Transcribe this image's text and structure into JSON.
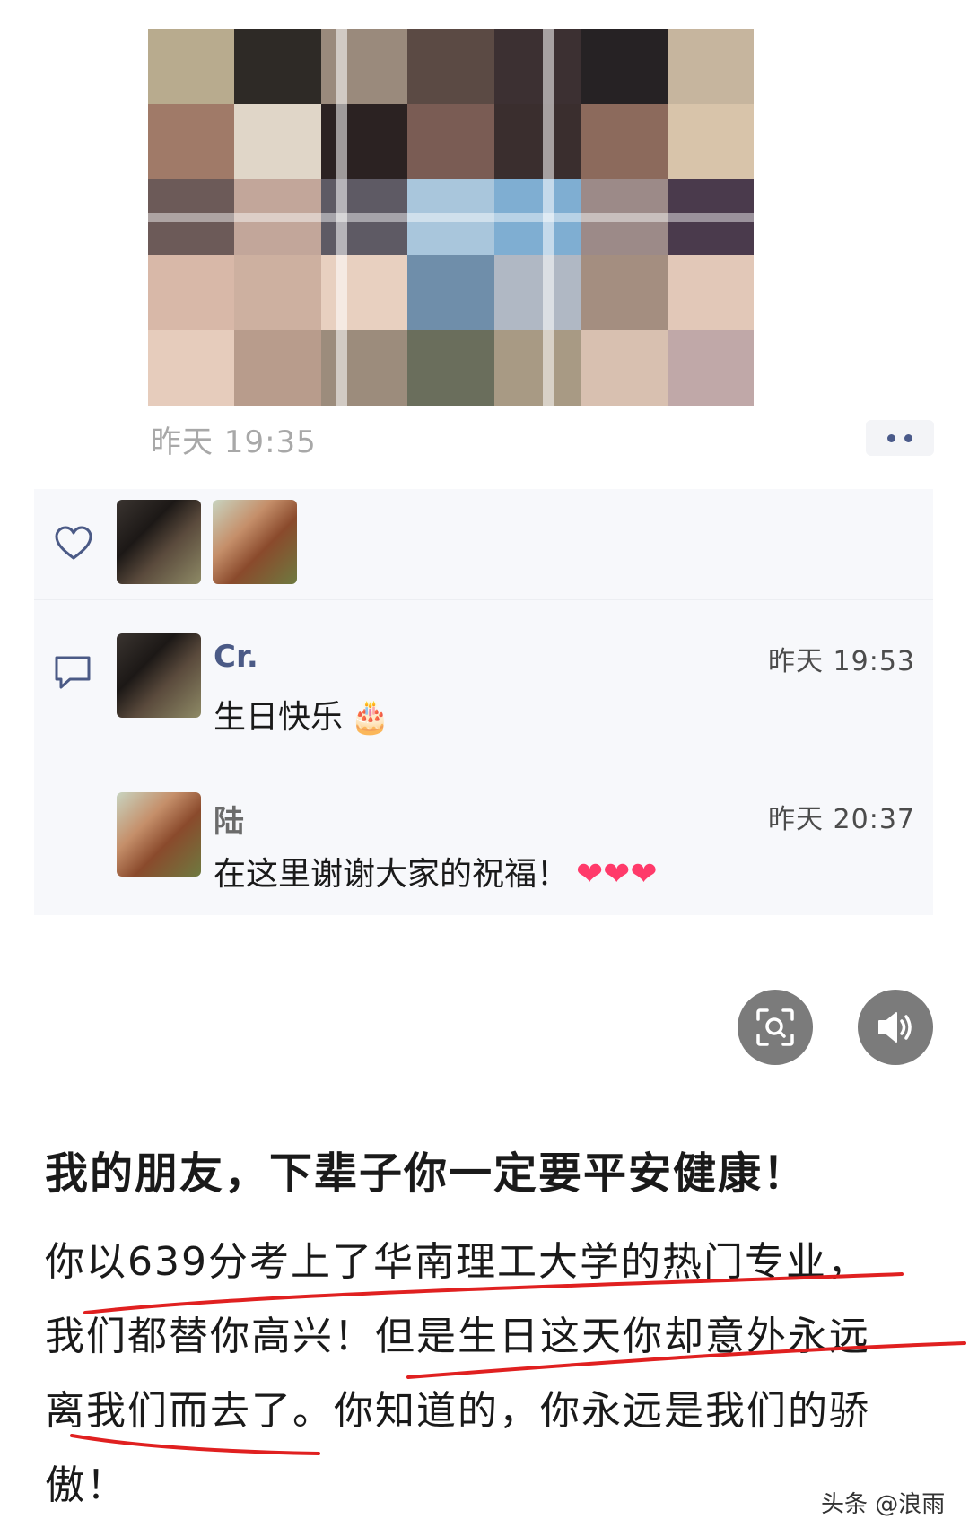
{
  "post": {
    "time": "昨天 19:35"
  },
  "mosaic_colors": [
    "#b8ab8e",
    "#2e2a26",
    "#9a8a7c",
    "#5b4a44",
    "#3c3032",
    "#262224",
    "#c6b59e",
    "#a07a68",
    "#e0d6c8",
    "#2b2222",
    "#7a5c54",
    "#3a2e2e",
    "#8c6a5c",
    "#d8c4aa",
    "#6c5a58",
    "#c2a69a",
    "#5e5a64",
    "#a9c6dc",
    "#7faed2",
    "#9c8a88",
    "#4a3a4c",
    "#d8b8a8",
    "#cdb0a0",
    "#e8d0c0",
    "#6f8eaa",
    "#b0b8c4",
    "#a48e80",
    "#e2c8b8",
    "#e6ccbc",
    "#b89c8c",
    "#9c8c7c",
    "#6a6e5c",
    "#a89a84",
    "#d8c0b0",
    "#c0a8a8"
  ],
  "likes": {
    "icon": "heart-outline-icon"
  },
  "comments": [
    {
      "name": "Cr.",
      "time": "昨天 19:53",
      "text": "生日快乐",
      "emoji": "🎂"
    },
    {
      "name": "陆",
      "time": "昨天 20:37",
      "text": "在这里谢谢大家的祝福！",
      "emoji": "❤❤❤"
    }
  ],
  "article": {
    "headline": "我的朋友，下辈子你一定要平安健康！",
    "lines": [
      "你以639分考上了华南理工大学的热门专业，",
      "我们都替你高兴！但是生日这天你却意外永远",
      "离我们而去了。你知道的，你永远是我们的骄",
      "傲！"
    ]
  },
  "watermark": "头条 @浪雨",
  "colors": {
    "name_blue": "#4b5a86",
    "underline_red": "#e02020"
  }
}
